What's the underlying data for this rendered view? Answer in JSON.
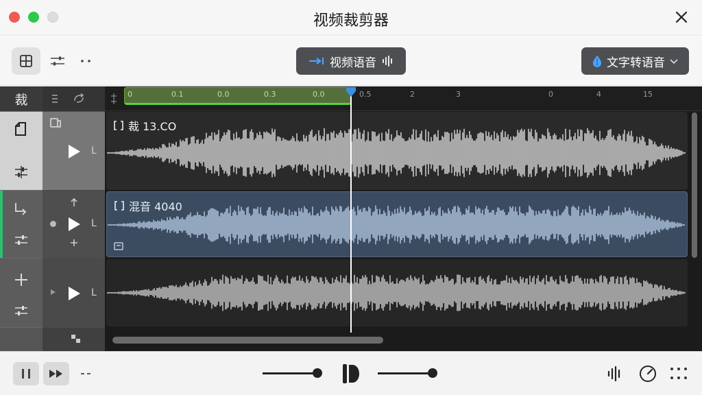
{
  "window": {
    "title": "视频裁剪器"
  },
  "toolbar": {
    "voice_button_label": "视频语音",
    "tts_button_label": "文字转语音"
  },
  "timeline": {
    "header_label": "裁",
    "ruler_ticks": [
      "0",
      "0.1",
      "0.0",
      "0.3",
      "0.0",
      "0.5",
      "0",
      "2",
      "3",
      "0",
      "4",
      "15"
    ],
    "tracks": [
      {
        "name": "裁 13.CO",
        "side_label": "L"
      },
      {
        "name": "混音 4040",
        "side_label": "L"
      },
      {
        "name": "",
        "side_label": "L"
      }
    ]
  },
  "colors": {
    "accent_green": "#2fbf71",
    "selection_green": "#5ad33a",
    "playhead_blue": "#3b8fe3",
    "button_dark": "#4d4f52"
  }
}
